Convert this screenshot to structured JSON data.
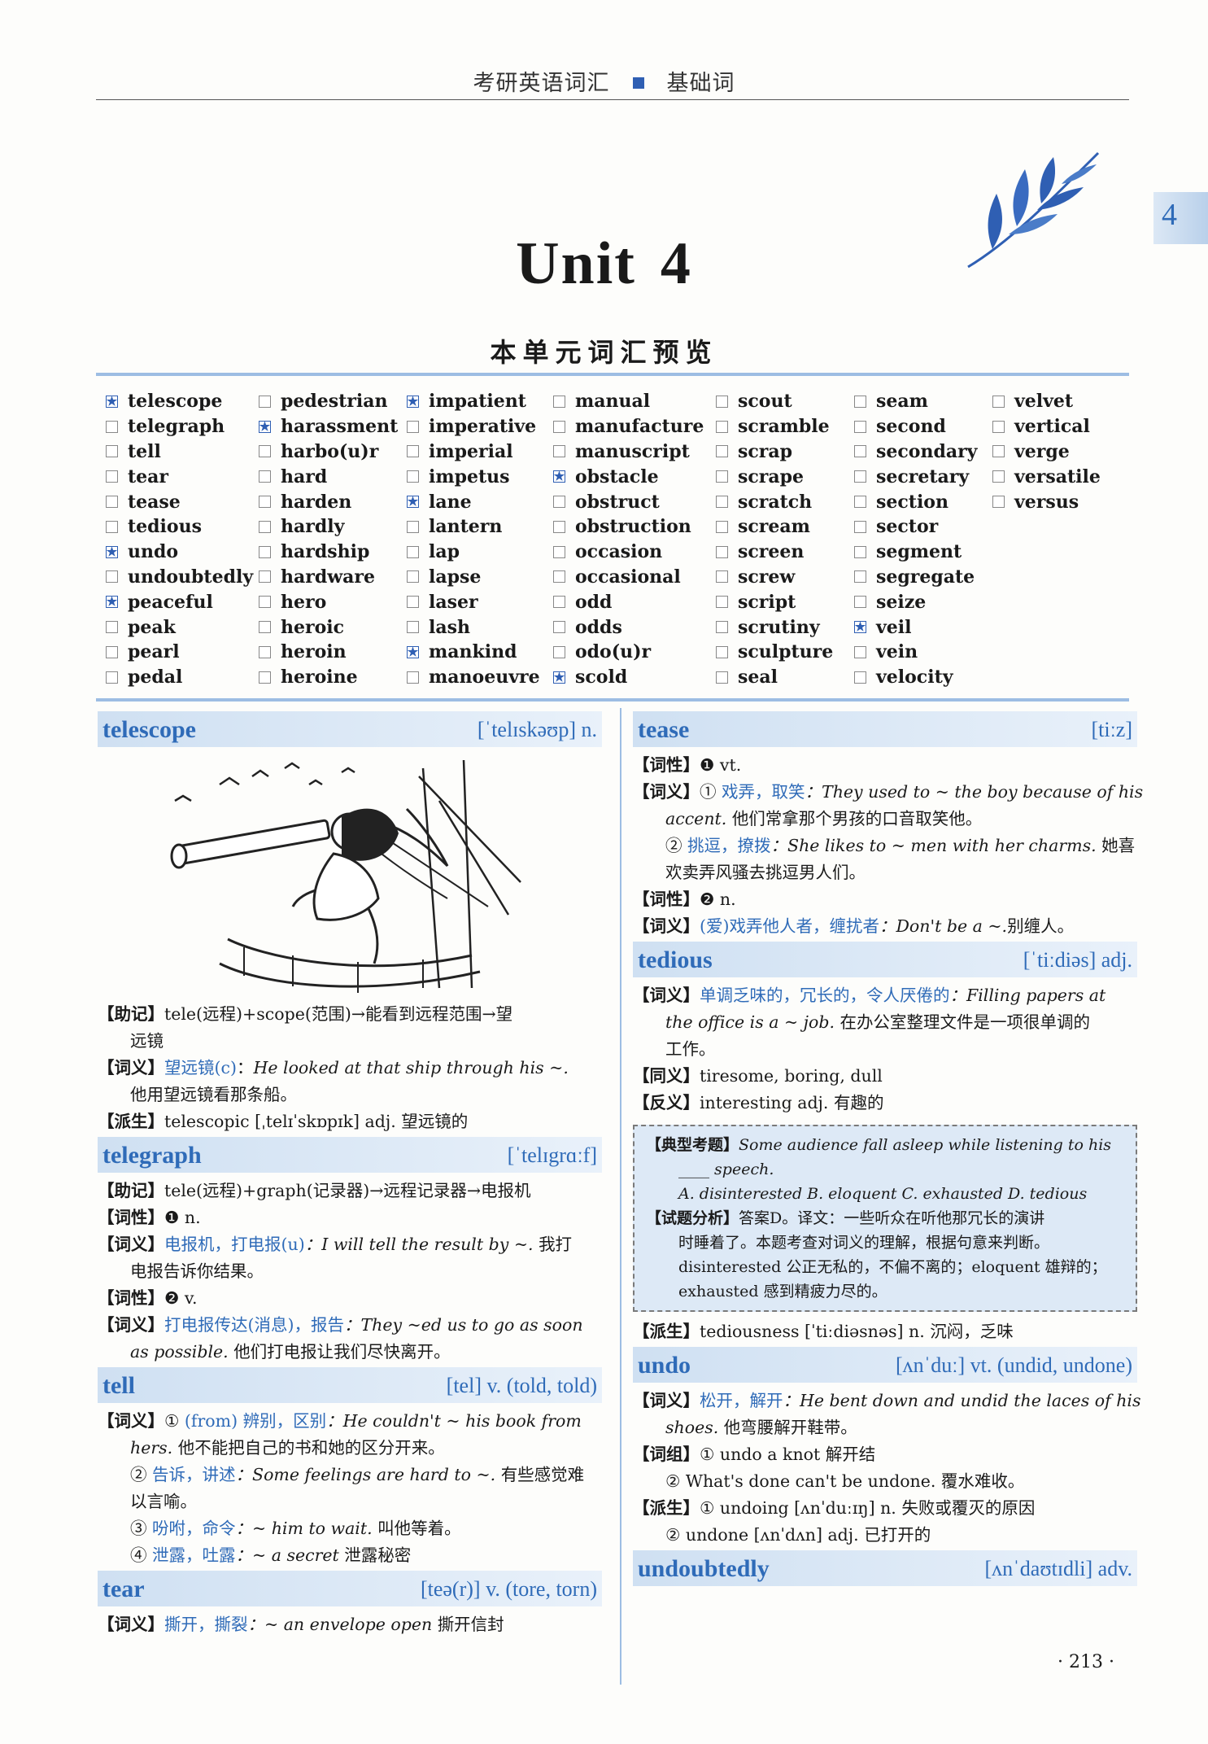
{
  "header": {
    "left": "考研英语词汇",
    "right": "基础词"
  },
  "side_tab": "4",
  "unit": {
    "word": "Unit",
    "number": "4"
  },
  "preview_title": "本单元词汇预览",
  "word_columns": [
    [
      {
        "w": "telescope",
        "s": true
      },
      {
        "w": "telegraph",
        "s": false
      },
      {
        "w": "tell",
        "s": false
      },
      {
        "w": "tear",
        "s": false
      },
      {
        "w": "tease",
        "s": false
      },
      {
        "w": "tedious",
        "s": false
      },
      {
        "w": "undo",
        "s": true
      },
      {
        "w": "undoubtedly",
        "s": false
      },
      {
        "w": "peaceful",
        "s": true
      },
      {
        "w": "peak",
        "s": false
      },
      {
        "w": "pearl",
        "s": false
      },
      {
        "w": "pedal",
        "s": false
      }
    ],
    [
      {
        "w": "pedestrian",
        "s": false
      },
      {
        "w": "harassment",
        "s": true
      },
      {
        "w": "harbo(u)r",
        "s": false
      },
      {
        "w": "hard",
        "s": false
      },
      {
        "w": "harden",
        "s": false
      },
      {
        "w": "hardly",
        "s": false
      },
      {
        "w": "hardship",
        "s": false
      },
      {
        "w": "hardware",
        "s": false
      },
      {
        "w": "hero",
        "s": false
      },
      {
        "w": "heroic",
        "s": false
      },
      {
        "w": "heroin",
        "s": false
      },
      {
        "w": "heroine",
        "s": false
      }
    ],
    [
      {
        "w": "impatient",
        "s": true
      },
      {
        "w": "imperative",
        "s": false
      },
      {
        "w": "imperial",
        "s": false
      },
      {
        "w": "impetus",
        "s": false
      },
      {
        "w": "lane",
        "s": true
      },
      {
        "w": "lantern",
        "s": false
      },
      {
        "w": "lap",
        "s": false
      },
      {
        "w": "lapse",
        "s": false
      },
      {
        "w": "laser",
        "s": false
      },
      {
        "w": "lash",
        "s": false
      },
      {
        "w": "mankind",
        "s": true
      },
      {
        "w": "manoeuvre",
        "s": false
      }
    ],
    [
      {
        "w": "manual",
        "s": false
      },
      {
        "w": "manufacture",
        "s": false
      },
      {
        "w": "manuscript",
        "s": false
      },
      {
        "w": "obstacle",
        "s": true
      },
      {
        "w": "obstruct",
        "s": false
      },
      {
        "w": "obstruction",
        "s": false
      },
      {
        "w": "occasion",
        "s": false
      },
      {
        "w": "occasional",
        "s": false
      },
      {
        "w": "odd",
        "s": false
      },
      {
        "w": "odds",
        "s": false
      },
      {
        "w": "odo(u)r",
        "s": false
      },
      {
        "w": "scold",
        "s": true
      }
    ],
    [
      {
        "w": "scout",
        "s": false
      },
      {
        "w": "scramble",
        "s": false
      },
      {
        "w": "scrap",
        "s": false
      },
      {
        "w": "scrape",
        "s": false
      },
      {
        "w": "scratch",
        "s": false
      },
      {
        "w": "scream",
        "s": false
      },
      {
        "w": "screen",
        "s": false
      },
      {
        "w": "screw",
        "s": false
      },
      {
        "w": "script",
        "s": false
      },
      {
        "w": "scrutiny",
        "s": false
      },
      {
        "w": "sculpture",
        "s": false
      },
      {
        "w": "seal",
        "s": false
      }
    ],
    [
      {
        "w": "seam",
        "s": false
      },
      {
        "w": "second",
        "s": false
      },
      {
        "w": "secondary",
        "s": false
      },
      {
        "w": "secretary",
        "s": false
      },
      {
        "w": "section",
        "s": false
      },
      {
        "w": "sector",
        "s": false
      },
      {
        "w": "segment",
        "s": false
      },
      {
        "w": "segregate",
        "s": false
      },
      {
        "w": "seize",
        "s": false
      },
      {
        "w": "veil",
        "s": true
      },
      {
        "w": "vein",
        "s": false
      },
      {
        "w": "velocity",
        "s": false
      }
    ],
    [
      {
        "w": "velvet",
        "s": false
      },
      {
        "w": "vertical",
        "s": false
      },
      {
        "w": "verge",
        "s": false
      },
      {
        "w": "versatile",
        "s": false
      },
      {
        "w": "versus",
        "s": false
      }
    ]
  ],
  "left": {
    "telescope": {
      "word": "telescope",
      "phon": "[ˈtelɪskəʊp] n.",
      "memo_tag": "【助记】",
      "memo": "tele(远程)+scope(范围)→能看到远程范围→望",
      "memo2": "远镜",
      "def_tag": "【词义】",
      "def_cn": "望远镜(c)",
      "def_sep": "：",
      "def_ex": "He looked at that ship through his ~.",
      "def_tr": "他用望远镜看那条船。",
      "der_tag": "【派生】",
      "der": "telescopic [ˌtelɪˈskɒpɪk] adj. 望远镜的"
    },
    "telegraph": {
      "word": "telegraph",
      "phon": "[ˈtelɪgrɑːf]",
      "memo_tag": "【助记】",
      "memo": "tele(远程)+graph(记录器)→远程记录器→电报机",
      "pos1_tag": "【词性】",
      "pos1": "❶ n.",
      "def1_tag": "【词义】",
      "def1_cn": "电报机，打电报(u)",
      "def1_ex": "：I will tell the result by ~.",
      "def1_tr": "我打",
      "def1_tr2": "电报告诉你结果。",
      "pos2_tag": "【词性】",
      "pos2": "❷ v.",
      "def2_tag": "【词义】",
      "def2_cn": "打电报传达(消息)，报告",
      "def2_ex": "：They ~ed us to go as soon",
      "def2_ex2": "as possible.",
      "def2_tr": "他们打电报让我们尽快离开。"
    },
    "tell": {
      "word": "tell",
      "phon": "[tel] v. (told, told)",
      "def_tag": "【词义】",
      "s1_num": "①",
      "s1_cn": "(from) 辨别，区别",
      "s1_ex": "：He couldn't ~ his book from",
      "s1_ex2": "hers.",
      "s1_tr": "他不能把自己的书和她的区分开来。",
      "s2_num": "②",
      "s2_cn": "告诉，讲述",
      "s2_ex": "：Some feelings are hard to ~.",
      "s2_tr": "有些感觉难",
      "s2_tr2": "以言喻。",
      "s3_num": "③",
      "s3_cn": "吩咐，命令",
      "s3_ex": "：~ him to wait.",
      "s3_tr": "叫他等着。",
      "s4_num": "④",
      "s4_cn": "泄露，吐露",
      "s4_ex": "：~ a secret",
      "s4_tr": "泄露秘密"
    },
    "tear": {
      "word": "tear",
      "phon": "[teə(r)] v. (tore, torn)",
      "def_tag": "【词义】",
      "def_cn": "撕开，撕裂",
      "def_ex": "：~ an envelope open",
      "def_tr": "撕开信封"
    }
  },
  "right": {
    "tease": {
      "word": "tease",
      "phon": "[tiːz]",
      "pos1_tag": "【词性】",
      "pos1": "❶ vt.",
      "def1_tag": "【词义】",
      "s1_num": "①",
      "s1_cn": "戏弄，取笑",
      "s1_ex": "：They used to ~ the boy because of his",
      "s1_ex2": "accent.",
      "s1_tr": "他们常拿那个男孩的口音取笑他。",
      "s2_num": "②",
      "s2_cn": "挑逗，撩拨",
      "s2_ex": "：She likes to ~ men with her charms.",
      "s2_tr": "她喜",
      "s2_tr2": "欢卖弄风骚去挑逗男人们。",
      "pos2_tag": "【词性】",
      "pos2": "❷ n.",
      "def2_tag": "【词义】",
      "def2_cn": "(爱)戏弄他人者，缠扰者",
      "def2_ex": "：Don't be a ~.",
      "def2_tr": "别缠人。"
    },
    "tedious": {
      "word": "tedious",
      "phon": "[ˈtiːdiəs] adj.",
      "def_tag": "【词义】",
      "def_cn": "单调乏味的，冗长的，令人厌倦的",
      "def_ex": "：Filling papers at",
      "def_ex2": "the office is a ~ job.",
      "def_tr": "在办公室整理文件是一项很单调的",
      "def_tr2": "工作。",
      "syn_tag": "【同义】",
      "syn": "tiresome, boring, dull",
      "ant_tag": "【反义】",
      "ant": "interesting adj. 有趣的",
      "exam_tag": "【典型考题】",
      "exam_q": "Some audience fall asleep while listening to his",
      "exam_q2": "____ speech.",
      "exam_opts": "A. disinterested   B. eloquent   C. exhausted   D. tedious",
      "ana_tag": "【试题分析】",
      "ana1": "答案D。译文：一些听众在听他那冗长的演讲",
      "ana2": "时睡着了。本题考查对词义的理解，根据句意来判断。",
      "ana3": "disinterested 公正无私的，不偏不离的；eloquent 雄辩的；",
      "ana4": "exhausted 感到精疲力尽的。",
      "der_tag": "【派生】",
      "der": "tediousness [ˈtiːdiəsnəs] n. 沉闷，乏味"
    },
    "undo": {
      "word": "undo",
      "phon": "[ʌnˈduː] vt. (undid, undone)",
      "def_tag": "【词义】",
      "def_cn": "松开，解开",
      "def_ex": "：He bent down and undid the laces of his",
      "def_ex2": "shoes.",
      "def_tr": "他弯腰解开鞋带。",
      "grp_tag": "【词组】",
      "grp1": "① undo a knot 解开结",
      "grp2": "② What's done can't be undone. 覆水难收。",
      "der_tag": "【派生】",
      "der1": "① undoing [ʌnˈduːɪŋ] n. 失败或覆灭的原因",
      "der2": "② undone [ʌnˈdʌn] adj. 已打开的"
    },
    "undoubtedly": {
      "word": "undoubtedly",
      "phon": "[ʌnˈdaʊtɪdli] adv."
    }
  },
  "page_number": "· 213 ·"
}
